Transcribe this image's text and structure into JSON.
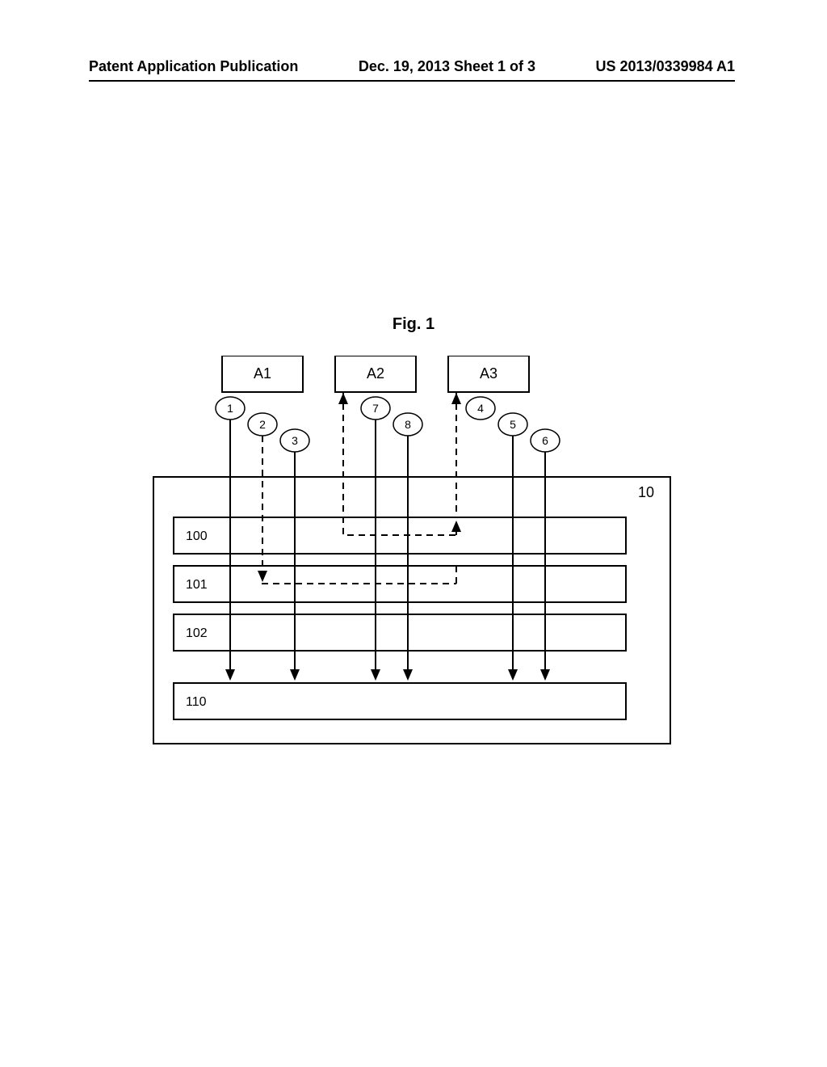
{
  "header": {
    "left": "Patent Application Publication",
    "center": "Dec. 19, 2013  Sheet 1 of 3",
    "right": "US 2013/0339984 A1"
  },
  "figure": {
    "title": "Fig. 1",
    "boxes": {
      "a1": "A1",
      "a2": "A2",
      "a3": "A3"
    },
    "ovals": {
      "o1": "1",
      "o2": "2",
      "o3": "3",
      "o4": "4",
      "o5": "5",
      "o6": "6",
      "o7": "7",
      "o8": "8"
    },
    "container_label": "10",
    "inner_labels": {
      "r100": "100",
      "r101": "101",
      "r102": "102",
      "r110": "110"
    }
  }
}
